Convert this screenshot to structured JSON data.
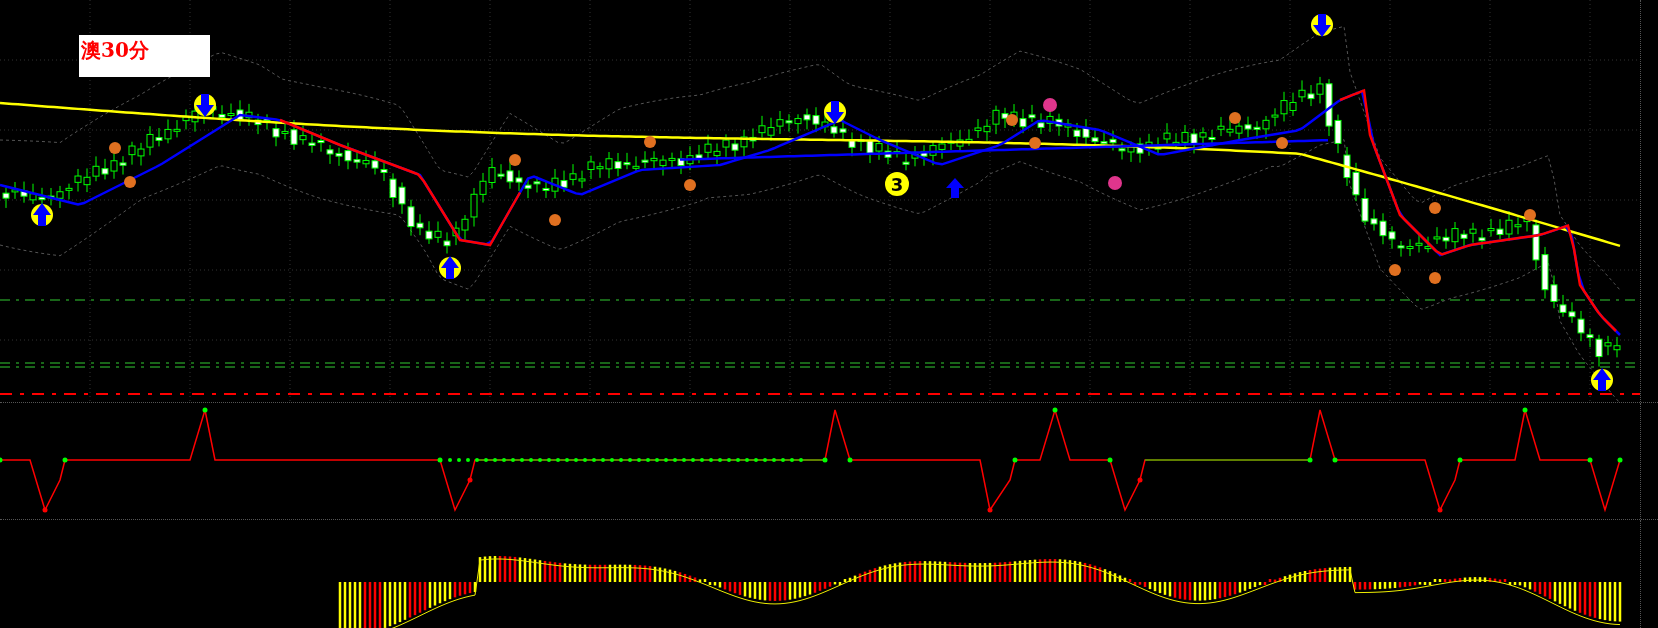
{
  "chart_label": {
    "text": "澳30分"
  },
  "signal_badges": [
    {
      "text": "3"
    }
  ]
}
